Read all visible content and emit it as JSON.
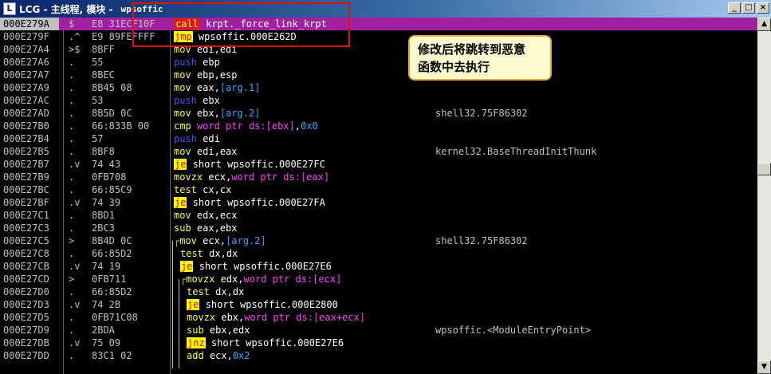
{
  "window": {
    "app_icon": "L",
    "title": "LCG - 主线程, 模块 -",
    "module": "wpsoffic",
    "buttons": {
      "minimize": "_",
      "maximize": "□",
      "close": "×"
    }
  },
  "annotation": {
    "line1": "修改后将跳转到恶意",
    "line2": "函数中去执行"
  },
  "scrollbar": {
    "up": "▲",
    "down": "▼"
  },
  "rows": [
    {
      "addr": "000E279A",
      "mark": "$",
      "hex": "E8 31ECF10F",
      "arrow": "",
      "mn": "call",
      "ops": [
        {
          "t": "krpt._force_link_krpt",
          "c": "op"
        }
      ],
      "cmt": "",
      "sel": true,
      "mncls": "m-call"
    },
    {
      "addr": "000E279F",
      "mark": ".^",
      "hex": "E9 89FEFFFF",
      "arrow": "",
      "mn": "jmp",
      "ops": [
        {
          "t": "wpsoffic.000E262D",
          "c": "op"
        }
      ],
      "cmt": "",
      "mncls": "m-jmp"
    },
    {
      "addr": "000E27A4",
      "mark": ">$",
      "hex": "8BFF",
      "arrow": "",
      "mn": "mov",
      "ops": [
        {
          "t": "edi,edi",
          "c": "op"
        }
      ],
      "cmt": "",
      "mncls": "m-mov"
    },
    {
      "addr": "000E27A6",
      "mark": ".",
      "hex": "55",
      "arrow": "",
      "mn": "push",
      "ops": [
        {
          "t": "ebp",
          "c": "op"
        }
      ],
      "cmt": "",
      "mncls": "m-push"
    },
    {
      "addr": "000E27A7",
      "mark": ".",
      "hex": "8BEC",
      "arrow": "",
      "mn": "mov",
      "ops": [
        {
          "t": "ebp,esp",
          "c": "op"
        }
      ],
      "cmt": "",
      "mncls": "m-mov"
    },
    {
      "addr": "000E27A9",
      "mark": ".",
      "hex": "8B45 08",
      "arrow": "",
      "mn": "mov",
      "ops": [
        {
          "t": "eax,",
          "c": "op"
        },
        {
          "t": "[arg.1]",
          "c": "arg"
        }
      ],
      "cmt": "",
      "mncls": "m-mov"
    },
    {
      "addr": "000E27AC",
      "mark": ".",
      "hex": "53",
      "arrow": "",
      "mn": "push",
      "ops": [
        {
          "t": "ebx",
          "c": "op"
        }
      ],
      "cmt": "",
      "mncls": "m-push"
    },
    {
      "addr": "000E27AD",
      "mark": ".",
      "hex": "8B5D 0C",
      "arrow": "",
      "mn": "mov",
      "ops": [
        {
          "t": "ebx,",
          "c": "op"
        },
        {
          "t": "[arg.2]",
          "c": "arg"
        }
      ],
      "cmt": "shell32.75F86302",
      "mncls": "m-mov"
    },
    {
      "addr": "000E27B0",
      "mark": ".",
      "hex": "66:833B 00",
      "arrow": "",
      "mn": "cmp",
      "ops": [
        {
          "t": "word ptr ds:[ebx]",
          "c": "ptr"
        },
        {
          "t": ",",
          "c": "op"
        },
        {
          "t": "0x0",
          "c": "imm"
        }
      ],
      "cmt": "",
      "mncls": "m-cmp"
    },
    {
      "addr": "000E27B4",
      "mark": ".",
      "hex": "57",
      "arrow": "",
      "mn": "push",
      "ops": [
        {
          "t": "edi",
          "c": "op"
        }
      ],
      "cmt": "",
      "mncls": "m-push"
    },
    {
      "addr": "000E27B5",
      "mark": ".",
      "hex": "8BF8",
      "arrow": "",
      "mn": "mov",
      "ops": [
        {
          "t": "edi,eax",
          "c": "op"
        }
      ],
      "cmt": "kernel32.BaseThreadInitThunk",
      "mncls": "m-mov"
    },
    {
      "addr": "000E27B7",
      "mark": ".v",
      "hex": "74 43",
      "arrow": "",
      "mn": "je",
      "ops": [
        {
          "t": "short wpsoffic.000E27FC",
          "c": "op"
        }
      ],
      "cmt": "",
      "mncls": "m-jcc"
    },
    {
      "addr": "000E27B9",
      "mark": ".",
      "hex": "0FB708",
      "arrow": "",
      "mn": "movzx",
      "ops": [
        {
          "t": "ecx,",
          "c": "op"
        },
        {
          "t": "word ptr ds:[eax]",
          "c": "ptr"
        }
      ],
      "cmt": "",
      "mncls": "m-mov"
    },
    {
      "addr": "000E27BC",
      "mark": ".",
      "hex": "66:85C9",
      "arrow": "",
      "mn": "test",
      "ops": [
        {
          "t": "cx,cx",
          "c": "op"
        }
      ],
      "cmt": "",
      "mncls": "m-test"
    },
    {
      "addr": "000E27BF",
      "mark": ".v",
      "hex": "74 39",
      "arrow": "",
      "mn": "je",
      "ops": [
        {
          "t": "short wpsoffic.000E27FA",
          "c": "op"
        }
      ],
      "cmt": "",
      "mncls": "m-jcc"
    },
    {
      "addr": "000E27C1",
      "mark": ".",
      "hex": "8BD1",
      "arrow": "",
      "mn": "mov",
      "ops": [
        {
          "t": "edx,ecx",
          "c": "op"
        }
      ],
      "cmt": "",
      "mncls": "m-mov"
    },
    {
      "addr": "000E27C3",
      "mark": ".",
      "hex": "2BC3",
      "arrow": "",
      "mn": "sub",
      "ops": [
        {
          "t": "eax,ebx",
          "c": "op"
        }
      ],
      "cmt": "",
      "mncls": "m-sub"
    },
    {
      "addr": "000E27C5",
      "mark": ">",
      "hex": "8B4D 0C",
      "arrow": "┌",
      "mn": "mov",
      "ops": [
        {
          "t": "ecx,",
          "c": "op"
        },
        {
          "t": "[arg.2]",
          "c": "arg"
        }
      ],
      "cmt": "shell32.75F86302",
      "mncls": "m-mov",
      "indent": 1
    },
    {
      "addr": "000E27C8",
      "mark": ".",
      "hex": "66:85D2",
      "arrow": "",
      "mn": "test",
      "ops": [
        {
          "t": "dx,dx",
          "c": "op"
        }
      ],
      "cmt": "",
      "mncls": "m-test",
      "indent": 1
    },
    {
      "addr": "000E27CB",
      "mark": ".v",
      "hex": "74 19",
      "arrow": "",
      "mn": "je",
      "ops": [
        {
          "t": "short wpsoffic.000E27E6",
          "c": "op"
        }
      ],
      "cmt": "",
      "mncls": "m-jcc",
      "indent": 1
    },
    {
      "addr": "000E27CD",
      "mark": ">",
      "hex": "0FB711",
      "arrow": "┌",
      "mn": "movzx",
      "ops": [
        {
          "t": "edx,",
          "c": "op"
        },
        {
          "t": "word ptr ds:[ecx]",
          "c": "ptr"
        }
      ],
      "cmt": "",
      "mncls": "m-mov",
      "indent": 2
    },
    {
      "addr": "000E27D0",
      "mark": ".",
      "hex": "66:85D2",
      "arrow": "",
      "mn": "test",
      "ops": [
        {
          "t": "dx,dx",
          "c": "op"
        }
      ],
      "cmt": "",
      "mncls": "m-test",
      "indent": 2
    },
    {
      "addr": "000E27D3",
      "mark": ".v",
      "hex": "74 2B",
      "arrow": "",
      "mn": "je",
      "ops": [
        {
          "t": "short wpsoffic.000E2800",
          "c": "op"
        }
      ],
      "cmt": "",
      "mncls": "m-jcc",
      "indent": 2
    },
    {
      "addr": "000E27D5",
      "mark": ".",
      "hex": "0FB71C08",
      "arrow": "",
      "mn": "movzx",
      "ops": [
        {
          "t": "ebx,",
          "c": "op"
        },
        {
          "t": "word ptr ds:[eax+ecx]",
          "c": "ptr"
        }
      ],
      "cmt": "",
      "mncls": "m-mov",
      "indent": 2
    },
    {
      "addr": "000E27D9",
      "mark": ".",
      "hex": "2BDA",
      "arrow": "",
      "mn": "sub",
      "ops": [
        {
          "t": "ebx,edx",
          "c": "op"
        }
      ],
      "cmt": "wpsoffic.<ModuleEntryPoint>",
      "mncls": "m-sub",
      "indent": 2
    },
    {
      "addr": "000E27DB",
      "mark": ".v",
      "hex": "75 09",
      "arrow": "",
      "mn": "jnz",
      "ops": [
        {
          "t": "short wpsoffic.000E27E6",
          "c": "op"
        }
      ],
      "cmt": "",
      "mncls": "m-jcc",
      "indent": 2
    },
    {
      "addr": "000E27DD",
      "mark": ".",
      "hex": "83C1 02",
      "arrow": "",
      "mn": "add",
      "ops": [
        {
          "t": "ecx,",
          "c": "op"
        },
        {
          "t": "0x2",
          "c": "imm"
        }
      ],
      "cmt": "",
      "mncls": "m-add",
      "indent": 2
    }
  ]
}
